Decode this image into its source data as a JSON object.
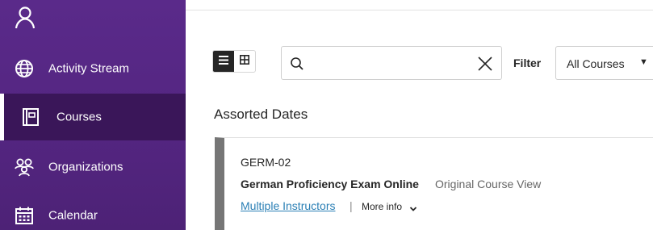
{
  "sidebar": {
    "user_icon": "user-icon",
    "items": [
      {
        "label": "Activity Stream",
        "icon": "globe-icon",
        "active": false
      },
      {
        "label": "Courses",
        "icon": "course-book-icon",
        "active": true
      },
      {
        "label": "Organizations",
        "icon": "organizations-icon",
        "active": false
      },
      {
        "label": "Calendar",
        "icon": "calendar-icon",
        "active": false
      }
    ],
    "colors": {
      "background": "#532580",
      "active_background": "#3a1659",
      "text": "#ffffff"
    }
  },
  "toolbar": {
    "view_list_icon": "list-view-icon",
    "view_grid_icon": "grid-view-icon",
    "search": {
      "value": "",
      "placeholder": ""
    },
    "filter_label": "Filter",
    "filter_value": "All Courses"
  },
  "section": {
    "title": "Assorted Dates"
  },
  "course": {
    "code": "GERM-02",
    "name": "German Proficiency Exam Online",
    "view": "Original Course View",
    "instructors": "Multiple Instructors",
    "separator": "|",
    "more_info": "More info"
  },
  "colors": {
    "link": "#2a7fb5",
    "card_accent": "#767676"
  }
}
